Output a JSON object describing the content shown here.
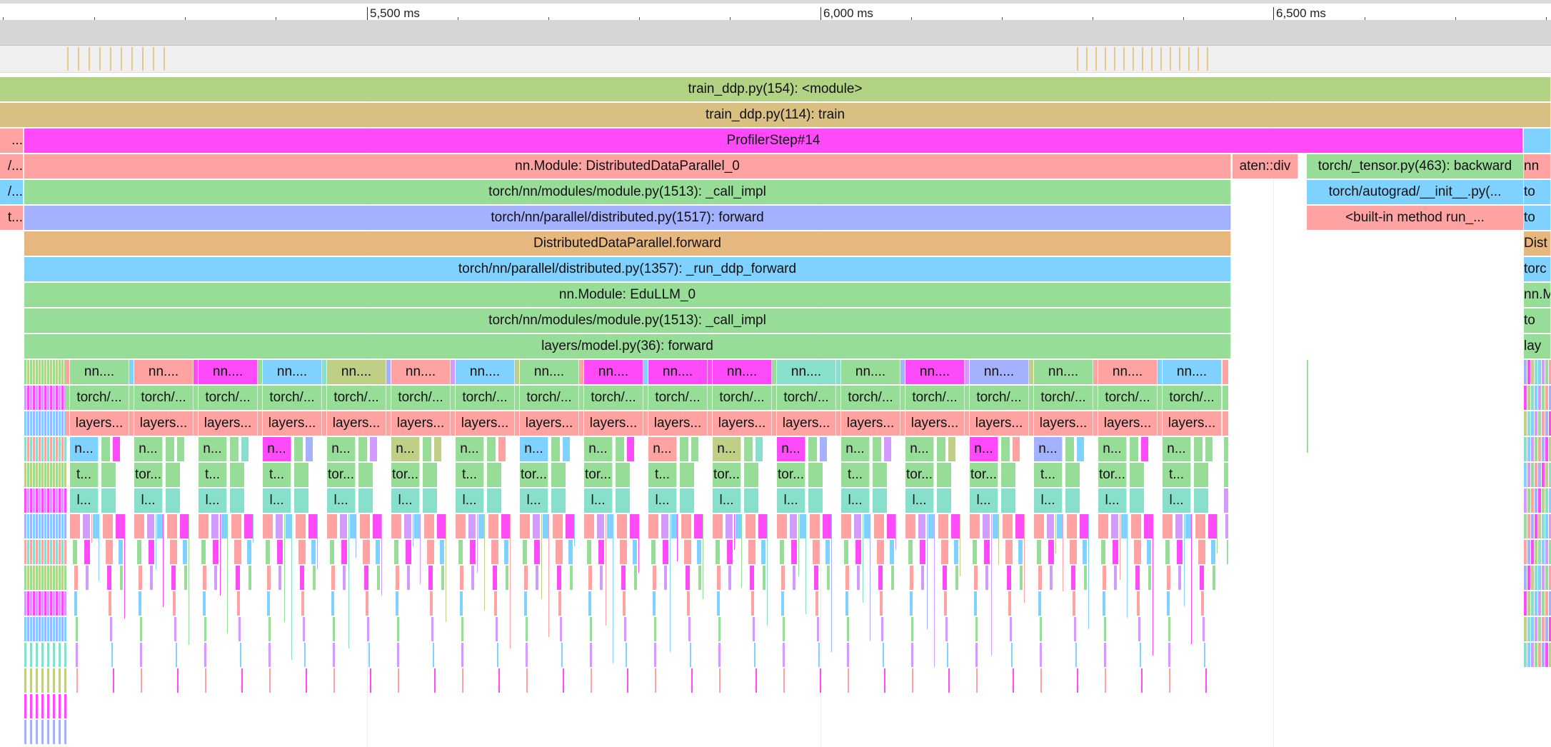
{
  "timeline": {
    "tick_labels": [
      "5,500 ms",
      "6,000 ms",
      "6,500 ms"
    ]
  },
  "slices": {
    "module": "train_ddp.py(154): <module>",
    "train": "train_ddp.py(114): train",
    "profiler_step": "ProfilerStep#14",
    "profiler_step_left_cut": "...",
    "ddp_module": "nn.Module: DistributedDataParallel_0",
    "ddp_module_left_cut": "/...",
    "call_impl_1": "torch/nn/modules/module.py(1513): _call_impl",
    "call_impl_1_left_cut": "/...",
    "dist_forward": "torch/nn/parallel/distributed.py(1517): forward",
    "dist_forward_left_cut": "t...",
    "ddp_forward": "DistributedDataParallel.forward",
    "run_ddp_forward": "torch/nn/parallel/distributed.py(1357): _run_ddp_forward",
    "edullm_module": "nn.Module: EduLLM_0",
    "call_impl_2": "torch/nn/modules/module.py(1513): _call_impl",
    "model_forward": "layers/model.py(36): forward",
    "overlap_label": "aten::div",
    "backward": "torch/_tensor.py(463): backward",
    "autograd_init": "torch/autograd/__init__.py(...",
    "builtin_run": "<built-in method run_...",
    "right_col_1": "nn",
    "right_col_2": "to",
    "right_col_3": "to",
    "right_col_4": "Dist",
    "right_col_5": "torc",
    "right_col_6": "nn.M",
    "right_col_7": "to",
    "right_col_8": "lay",
    "layer_module": "nn....",
    "layer_call": "torch/...",
    "layer_forward": "layers...",
    "layer_sub_1": [
      "n...",
      "n...",
      "n...",
      "n...",
      "n...",
      "n...",
      "n...",
      "n...",
      "n...",
      "n...",
      "n...",
      "n...",
      "n...",
      "n...",
      "n...",
      "n...",
      "n...",
      "n..."
    ],
    "layer_sub_2": [
      "t...",
      "tor...",
      "t...",
      "t...",
      "tor...",
      "tor...",
      "t...",
      "tor...",
      "tor...",
      "t...",
      "tor...",
      "tor...",
      "t...",
      "tor...",
      "tor...",
      "t...",
      "tor...",
      "t..."
    ],
    "layer_sub_3": "l..."
  },
  "colors": {
    "green": "#b3d384",
    "tan": "#d9bf82",
    "magenta": "#ff4af9",
    "salmon": "#ffa2a2",
    "mint": "#97dd98",
    "periwinkle": "#a3b1ff",
    "orange_tan": "#e6b77e",
    "sky": "#7fd1ff",
    "teal": "#88e0cc",
    "violet": "#d49bff",
    "olive": "#bfcf86"
  }
}
